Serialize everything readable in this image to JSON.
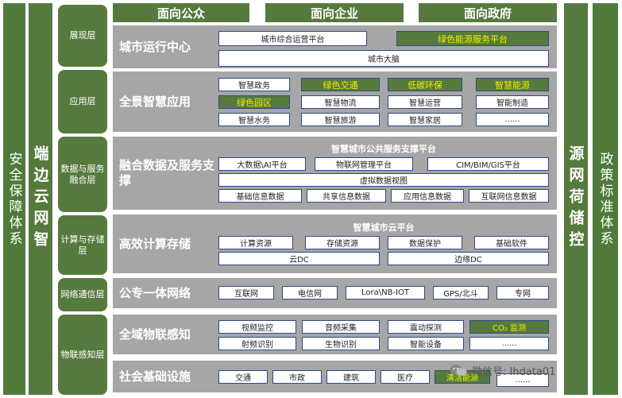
{
  "left_outer": "安全保障体系",
  "left_inner": "端边云网智",
  "right_inner": "源网荷储控",
  "right_outer": "政策标准体系",
  "headers": [
    "面向公众",
    "面向企业",
    "面向政府"
  ],
  "layer_labels": {
    "display": "展现层",
    "application": "应用层",
    "data_service": "数据与服务融合层",
    "compute": "计算与存储层",
    "network": "网络通信层",
    "iot": "物联感知层"
  },
  "bands": {
    "city_ops": {
      "title": "城市运行中心",
      "items": [
        "城市综合运营平台",
        "绿色能源服务平台",
        "城市大脑"
      ]
    },
    "smart_apps": {
      "title": "全景智慧应用",
      "items": [
        "智慧政务",
        "绿色交通",
        "低碳环保",
        "智慧能源",
        "绿色园区",
        "智慧物流",
        "智慧运营",
        "智能制造",
        "智慧水务",
        "智慧旅游",
        "智慧家居",
        "......"
      ]
    },
    "data_support": {
      "title": "融合数据及服务支撑",
      "subtitle": "智慧城市公共服务支撑平台",
      "items": [
        "大数据\\AI平台",
        "物联网管理平台",
        "CIM/BIM/GIS平台",
        "虚拟数据视图",
        "基础信息数据",
        "共享信息数据",
        "应用信息数据",
        "互联网信息数据"
      ]
    },
    "compute": {
      "title": "高效计算存储",
      "subtitle": "智慧城市云平台",
      "items": [
        "计算资源",
        "存储资源",
        "数据保护",
        "基础软件",
        "云DC",
        "边缘DC"
      ]
    },
    "network": {
      "title": "公专一体网络",
      "items": [
        "互联网",
        "电信网",
        "Lora\\NB-IOT",
        "GPS/北斗",
        "专网"
      ]
    },
    "sensing": {
      "title": "全域物联感知",
      "items": [
        "视频监控",
        "音频采集",
        "震动探测",
        "CO₂ 监测",
        "射频识别",
        "生物识别",
        "智能设备",
        "......"
      ]
    },
    "infra": {
      "title": "社会基础设施",
      "items": [
        "交通",
        "市政",
        "建筑",
        "医疗",
        "清洁能源",
        "......"
      ]
    }
  },
  "watermark": "微信号: Ihdata01",
  "colors": {
    "green": "#567a3e",
    "gray": "#a6a6a6",
    "yellow_text": "#f2ef00",
    "border_blue": "#2f4a86"
  }
}
